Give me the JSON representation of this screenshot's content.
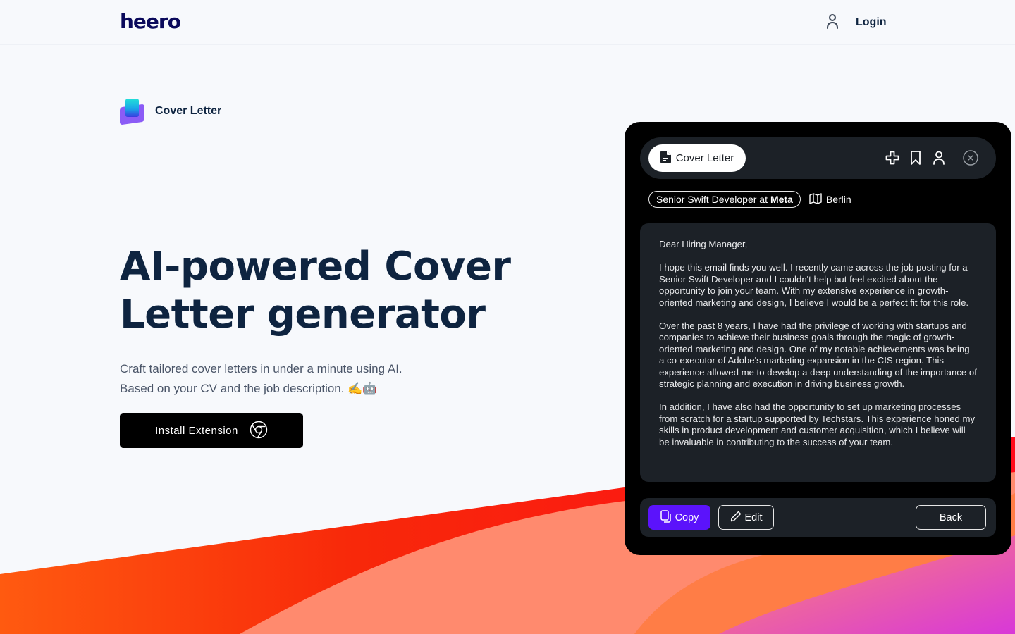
{
  "header": {
    "logo": "heero",
    "login_label": "Login",
    "login_icon": "user-icon"
  },
  "hero": {
    "product_tag": "Cover Letter",
    "product_icon": "cover-letter-logo-icon",
    "title_line1": "AI-powered Cover",
    "title_line2": "Letter generator",
    "subtitle_line1": "Craft tailored cover letters in under a minute using AI.",
    "subtitle_line2": "Based on your CV and the job description. ✍️🤖",
    "install_label": "Install Extension",
    "install_icon": "chrome-icon"
  },
  "panel": {
    "tab_label": "Cover Letter",
    "tab_icon": "document-icon",
    "toolbar_icons": [
      "puzzle-plus-icon",
      "bookmark-icon",
      "user-icon"
    ],
    "close_icon": "close-circle-icon",
    "job": {
      "title": "Senior Swift Developer at",
      "company": "Meta",
      "location": "Berlin",
      "location_icon": "map-icon"
    },
    "letter": {
      "greeting": "Dear Hiring Manager,",
      "paragraphs": [
        "I hope this email finds you well. I recently came across the job posting for a Senior Swift Developer and I couldn't help but feel excited about the opportunity to join your team. With my extensive experience in growth-oriented marketing and design, I believe I would be a perfect fit for this role.",
        "Over the past 8 years, I have had the privilege of working with startups and companies to achieve their business goals through the magic of growth-oriented marketing and design. One of my notable achievements was being a co-executor of Adobe's marketing expansion in the CIS region. This experience allowed me to develop a deep understanding of the importance of strategic planning and execution in driving business growth.",
        "In addition, I have also had the opportunity to set up marketing processes from scratch for a startup supported by Techstars. This experience honed my skills in product development and customer acquisition, which I believe will be invaluable in contributing to the success of your team."
      ]
    },
    "actions": {
      "copy_label": "Copy",
      "edit_label": "Edit",
      "back_label": "Back"
    },
    "colors": {
      "accent": "#5b13fb",
      "panel_bg": "#000000",
      "surface": "#1c2127"
    }
  },
  "colors": {
    "brand": "#0b0a5c",
    "heading": "#0e2440",
    "background": "#f7f9fc"
  }
}
